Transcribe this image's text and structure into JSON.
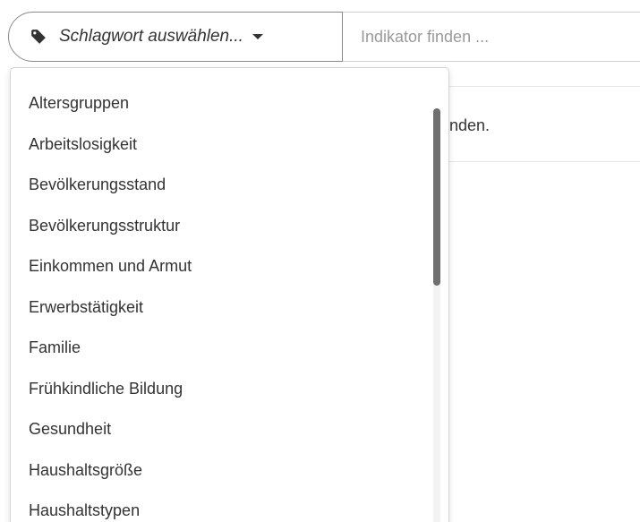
{
  "search": {
    "tag_select_label": "Schlagwort auswählen...",
    "tag_icon": "tag-icon",
    "caret_icon": "caret-down-icon",
    "indicator_placeholder": "Indikator finden ..."
  },
  "content": {
    "partial_text": "inden."
  },
  "dropdown": {
    "items": [
      "Altersgruppen",
      "Arbeitslosigkeit",
      "Bevölkerungsstand",
      "Bevölkerungsstruktur",
      "Einkommen und Armut",
      "Erwerbstätigkeit",
      "Familie",
      "Frühkindliche Bildung",
      "Gesundheit",
      "Haushaltsgröße",
      "Haushaltstypen"
    ]
  }
}
